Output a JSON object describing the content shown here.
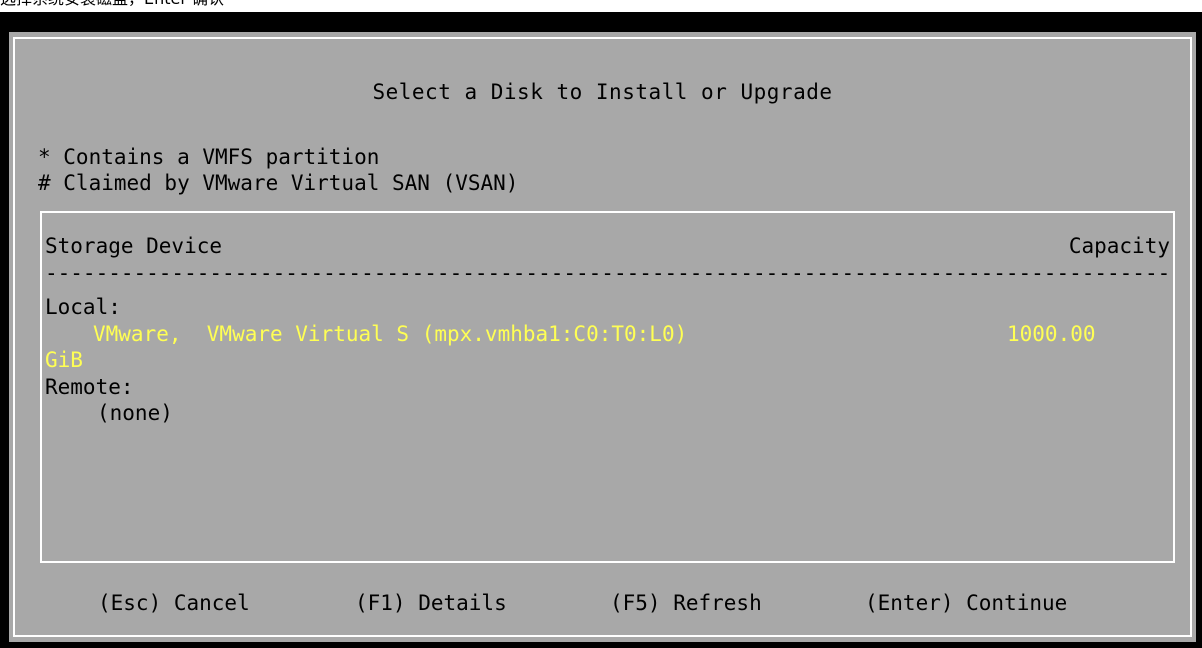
{
  "caption": "选择系统安装磁盘，Enter 确认",
  "dialog": {
    "title": "Select a Disk to Install or Upgrade",
    "legend": [
      "* Contains a VMFS partition",
      "# Claimed by VMware Virtual SAN (VSAN)"
    ]
  },
  "table": {
    "columns": {
      "device": "Storage Device",
      "capacity": "Capacity"
    },
    "separator": "--------------------------------------------------------------------------------------------",
    "local_label": "Local:",
    "local_disks": [
      {
        "name": "VMware,  VMware Virtual S (mpx.vmhba1:C0:T0:L0)",
        "capacity": "1000.00",
        "unit": "GiB",
        "selected": true
      }
    ],
    "remote_label": "Remote:",
    "remote_value": "(none)"
  },
  "keys": {
    "cancel": "(Esc) Cancel",
    "details": "(F1) Details",
    "refresh": "(F5) Refresh",
    "continue": "(Enter) Continue"
  },
  "colors": {
    "background": "#000000",
    "dialog": "#a8a8a8",
    "border": "#ffffff",
    "text": "#000000",
    "highlight": "#ffff54"
  }
}
